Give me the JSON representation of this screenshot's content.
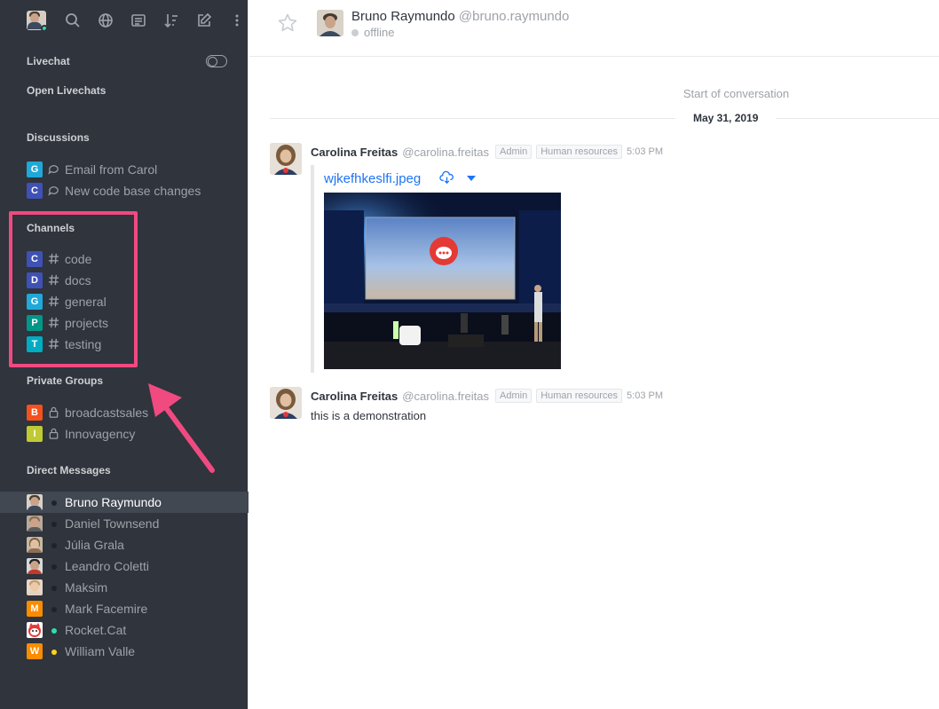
{
  "sidebar": {
    "sections": {
      "livechat": "Livechat",
      "open_livechats": "Open Livechats",
      "discussions": "Discussions",
      "channels": "Channels",
      "private_groups": "Private Groups",
      "direct_messages": "Direct Messages"
    },
    "discussions": [
      {
        "initial": "G",
        "label": "Email from Carol",
        "color": "#20a8d8"
      },
      {
        "initial": "C",
        "label": "New code base changes",
        "color": "#3f51b5"
      }
    ],
    "channels": [
      {
        "initial": "C",
        "label": "code",
        "color": "#3f51b5"
      },
      {
        "initial": "D",
        "label": "docs",
        "color": "#3f51b5"
      },
      {
        "initial": "G",
        "label": "general",
        "color": "#20a8d8"
      },
      {
        "initial": "P",
        "label": "projects",
        "color": "#009688"
      },
      {
        "initial": "T",
        "label": "testing",
        "color": "#00acc1"
      }
    ],
    "private_groups": [
      {
        "initial": "B",
        "label": "broadcastsales",
        "color": "#f4511e"
      },
      {
        "initial": "I",
        "label": "Innovagency",
        "color": "#c0ca33"
      }
    ],
    "direct_messages": [
      {
        "label": "Bruno Raymundo",
        "type": "photo",
        "status": "offline"
      },
      {
        "label": "Daniel Townsend",
        "type": "photo",
        "status": "offline"
      },
      {
        "label": "Júlia Grala",
        "type": "photo",
        "status": "offline"
      },
      {
        "label": "Leandro Coletti",
        "type": "photo",
        "status": "offline"
      },
      {
        "label": "Maksim",
        "type": "photo",
        "status": "offline"
      },
      {
        "label": "Mark Facemire",
        "type": "initial",
        "initial": "M",
        "color": "#fb8c00",
        "status": "offline"
      },
      {
        "label": "Rocket.Cat",
        "type": "cat",
        "status": "online"
      },
      {
        "label": "William Valle",
        "type": "initial",
        "initial": "W",
        "color": "#fb8c00",
        "status": "away"
      }
    ],
    "status_colors": {
      "online": "#2de0a5",
      "away": "#ffd21f",
      "offline": "#1f2329"
    }
  },
  "header": {
    "name": "Bruno Raymundo",
    "username": "@bruno.raymundo",
    "status": "offline"
  },
  "conversation": {
    "start_label": "Start of conversation",
    "date_label": "May 31, 2019",
    "messages": [
      {
        "author": "Carolina Freitas",
        "handle": "@carolina.freitas",
        "roles": [
          "Admin",
          "Human resources"
        ],
        "time": "5:03 PM",
        "attachment": {
          "filename": "wjkefhkeslfi.jpeg"
        }
      },
      {
        "author": "Carolina Freitas",
        "handle": "@carolina.freitas",
        "roles": [
          "Admin",
          "Human resources"
        ],
        "time": "5:03 PM",
        "text": "this is a demonstration"
      }
    ]
  },
  "colors": {
    "sidebar_bg": "#2f343d",
    "link": "#1d74f5",
    "annotation": "#f04a80"
  }
}
